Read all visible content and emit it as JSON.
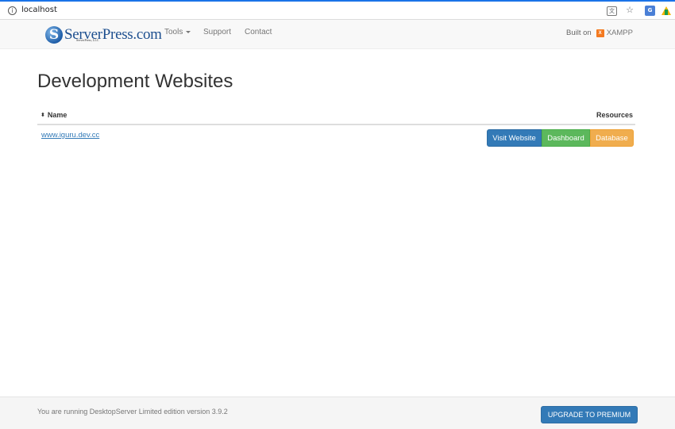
{
  "browser": {
    "url": "localhost",
    "info_icon": "info-icon",
    "translate_icon": "translate-icon",
    "star_icon": "star-icon",
    "extension_icons": [
      "google-translate-extension-icon",
      "google-drive-icon"
    ]
  },
  "navbar": {
    "logo_text": "ServerPress.com",
    "logo_sub": "ServerPress, LLC",
    "links": {
      "tools": "Tools",
      "support": "Support",
      "contact": "Contact"
    },
    "built_on_label": "Built on",
    "platform": "XAMPP",
    "platform_icon": "xampp-icon"
  },
  "main": {
    "title": "Development Websites",
    "table": {
      "columns": {
        "name": "Name",
        "resources": "Resources"
      },
      "rows": [
        {
          "site": "www.iguru.dev.cc",
          "actions": {
            "visit": "Visit Website",
            "dashboard": "Dashboard",
            "database": "Database"
          }
        }
      ]
    }
  },
  "footer": {
    "text": "You are running DesktopServer Limited edition version 3.9.2",
    "upgrade_label": "UPGRADE TO PREMIUM"
  },
  "colors": {
    "primary": "#337ab7",
    "success": "#5cb85c",
    "warning": "#f0ad4e",
    "xampp": "#f47a20"
  }
}
